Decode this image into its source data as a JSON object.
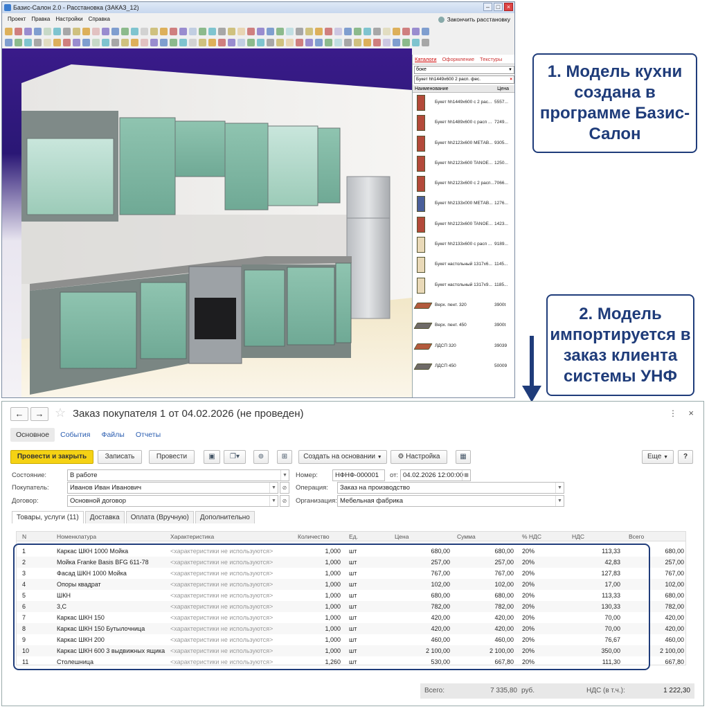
{
  "bazis": {
    "window_title": "Базис-Салон 2.0 - Расстановка (ЗАКАЗ_12)",
    "menu": [
      "Проект",
      "Правка",
      "Настройки",
      "Справка"
    ],
    "finish_label": "Закончить расстановку",
    "panel": {
      "tabs": [
        "Каталоги",
        "Оформление",
        "Текстуры"
      ],
      "combo_value": "боке",
      "search_value": "Букет hh1449x600 2 расп. фес.",
      "col_name": "Наименование",
      "col_price": "Цена",
      "items": [
        {
          "name": "Букет hh1449x600 с 2 рас...",
          "price": "5557..."
        },
        {
          "name": "Букет hh1489x600 с расп ...",
          "price": "7249..."
        },
        {
          "name": "Букет hh2123x600 МЕТАВ...",
          "price": "9305..."
        },
        {
          "name": "Букет hh2123x600 TANOE...",
          "price": "1250..."
        },
        {
          "name": "Букет hh2123x600 с 2 расп...",
          "price": "7066..."
        },
        {
          "name": "Букет hh2133x000 МЕТАВ...",
          "price": "1276..."
        },
        {
          "name": "Букет hh2123x600 TANOE...",
          "price": "1423..."
        },
        {
          "name": "Букет hh2133x600 с расп ...",
          "price": "9189..."
        },
        {
          "name": "Букет настольный 1317x6...",
          "price": "1145..."
        },
        {
          "name": "Букет настольный 1317x9...",
          "price": "1185..."
        },
        {
          "name": "Верх. пент. 320",
          "price": "3900t"
        },
        {
          "name": "Верх. пент. 450",
          "price": "3900t"
        },
        {
          "name": "ЛДСП 320",
          "price": "39039"
        },
        {
          "name": "ЛДСП 450",
          "price": "50009"
        }
      ]
    }
  },
  "callouts": {
    "step1": "1. Модель кухни создана в программе Базис-Салон",
    "step2": "2. Модель импортируется в заказ клиента системы УНФ"
  },
  "onec": {
    "back": "←",
    "forward": "→",
    "star": "☆",
    "title": "Заказ покупателя 1 от 04.02.2026 (не проведен)",
    "more": "⋮",
    "close": "×",
    "tabs": [
      "Основное",
      "События",
      "Файлы",
      "Отчеты"
    ],
    "buttons": {
      "post_close": "Провести и закрыть",
      "save": "Записать",
      "post": "Провести",
      "create_based": "Создать на основании",
      "settings": "Настройка",
      "more": "Еще",
      "help": "?"
    },
    "fields": {
      "state_label": "Состояние:",
      "state": "В работе",
      "buyer_label": "Покупатель:",
      "buyer": "Иванов Иван Иванович",
      "contract_label": "Договор:",
      "contract": "Основной договор",
      "number_label": "Номер:",
      "number": "НФНФ-000001",
      "date_label": "от:",
      "date": "04.02.2026 12:00:00",
      "operation_label": "Операция:",
      "operation": "Заказ на производство",
      "org_label": "Организация:",
      "org": "Мебельная фабрика"
    },
    "subtabs": [
      "Товары, услуги (11)",
      "Доставка",
      "Оплата (Вручную)",
      "Дополнительно"
    ],
    "columns": [
      "N",
      "Номенклатура",
      "Характеристика",
      "Количество",
      "Ед.",
      "Цена",
      "Сумма",
      "% НДС",
      "НДС",
      "Всего"
    ],
    "rows": [
      [
        "1",
        "Каркас ШКН 1000 Мойка",
        "<характеристики не используются>",
        "1,000",
        "шт",
        "680,00",
        "680,00",
        "20%",
        "113,33",
        "680,00"
      ],
      [
        "2",
        "Мойка Franke Basis BFG 611-78",
        "<характеристики не используются>",
        "1,000",
        "шт",
        "257,00",
        "257,00",
        "20%",
        "42,83",
        "257,00"
      ],
      [
        "3",
        "Фасад ШКН 1000 Мойка",
        "<характеристики не используются>",
        "1,000",
        "шт",
        "767,00",
        "767,00",
        "20%",
        "127,83",
        "767,00"
      ],
      [
        "4",
        "Опоры квадрат",
        "<характеристики не используются>",
        "1,000",
        "шт",
        "102,00",
        "102,00",
        "20%",
        "17,00",
        "102,00"
      ],
      [
        "5",
        "ШКН",
        "<характеристики не используются>",
        "1,000",
        "шт",
        "680,00",
        "680,00",
        "20%",
        "113,33",
        "680,00"
      ],
      [
        "6",
        "3,С",
        "<характеристики не используются>",
        "1,000",
        "шт",
        "782,00",
        "782,00",
        "20%",
        "130,33",
        "782,00"
      ],
      [
        "7",
        "Каркас ШКН 150",
        "<характеристики не используются>",
        "1,000",
        "шт",
        "420,00",
        "420,00",
        "20%",
        "70,00",
        "420,00"
      ],
      [
        "8",
        "Каркас ШКН 150 Бутылочница",
        "<характеристики не используются>",
        "1,000",
        "шт",
        "420,00",
        "420,00",
        "20%",
        "70,00",
        "420,00"
      ],
      [
        "9",
        "Каркас ШКН 200",
        "<характеристики не используются>",
        "1,000",
        "шт",
        "460,00",
        "460,00",
        "20%",
        "76,67",
        "460,00"
      ],
      [
        "10",
        "Каркас ШКН 600 3 выдвижных ящика",
        "<характеристики не используются>",
        "1,000",
        "шт",
        "2 100,00",
        "2 100,00",
        "20%",
        "350,00",
        "2 100,00"
      ],
      [
        "11",
        "Столешница",
        "<характеристики не используются>",
        "1,260",
        "шт",
        "530,00",
        "667,80",
        "20%",
        "111,30",
        "667,80"
      ]
    ],
    "footer": {
      "total_label": "Всего:",
      "total": "7 335,80",
      "currency": "руб.",
      "vat_label": "НДС (в т.ч.):",
      "vat": "1 222,30"
    }
  },
  "colors": {
    "accent_navy": "#1f3c7a",
    "primary_button": "#f5d214",
    "link": "#2a5db0"
  }
}
